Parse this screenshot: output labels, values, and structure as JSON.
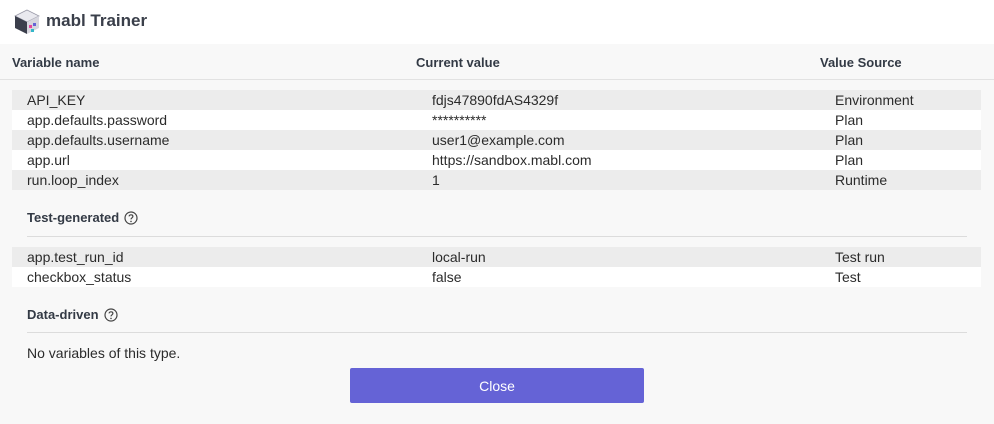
{
  "app": {
    "title": "mabl Trainer"
  },
  "columns": {
    "name": "Variable name",
    "value": "Current value",
    "source": "Value Source"
  },
  "variables": [
    {
      "name": "API_KEY",
      "value": "fdjs47890fdAS4329f",
      "source": "Environment"
    },
    {
      "name": "app.defaults.password",
      "value": "**********",
      "source": "Plan"
    },
    {
      "name": "app.defaults.username",
      "value": "user1@example.com",
      "source": "Plan"
    },
    {
      "name": "app.url",
      "value": "https://sandbox.mabl.com",
      "source": "Plan"
    },
    {
      "name": "run.loop_index",
      "value": "1",
      "source": "Runtime"
    }
  ],
  "test_generated": {
    "title": "Test-generated",
    "rows": [
      {
        "name": "app.test_run_id",
        "value": "local-run",
        "source": "Test run"
      },
      {
        "name": "checkbox_status",
        "value": "false",
        "source": "Test"
      }
    ]
  },
  "data_driven": {
    "title": "Data-driven",
    "empty_message": "No variables of this type."
  },
  "buttons": {
    "close": "Close"
  },
  "colors": {
    "accent": "#6563d6",
    "row_shade": "#ececec",
    "background": "#f8f8f8"
  }
}
